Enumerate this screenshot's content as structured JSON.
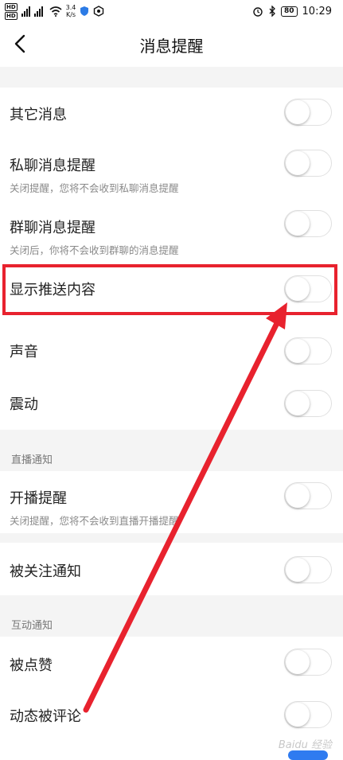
{
  "status_bar": {
    "hd1": "HD",
    "hd2": "HD",
    "net_speed_value": "3.4",
    "net_speed_unit": "K/s",
    "battery": "80",
    "time": "10:29"
  },
  "header": {
    "title": "消息提醒"
  },
  "settings": [
    {
      "label": "其它消息",
      "enabled": false
    },
    {
      "label": "私聊消息提醒",
      "sub": "关闭提醒，您将不会收到私聊消息提醒",
      "enabled": false
    },
    {
      "label": "群聊消息提醒",
      "sub": "关闭后，你将不会收到群聊的消息提醒",
      "enabled": false
    },
    {
      "label": "显示推送内容",
      "enabled": false
    },
    {
      "label": "声音",
      "enabled": false
    },
    {
      "label": "震动",
      "enabled": false
    }
  ],
  "live_section": {
    "title": "直播通知",
    "items": [
      {
        "label": "开播提醒",
        "sub": "关闭提醒，您将不会收到直播开播提醒",
        "enabled": false
      },
      {
        "label": "被关注通知",
        "enabled": false
      }
    ]
  },
  "interaction_section": {
    "title": "互动通知",
    "items": [
      {
        "label": "被点赞",
        "enabled": false
      },
      {
        "label": "动态被评论",
        "enabled": false
      }
    ]
  },
  "annotation": {
    "color": "#e8222e"
  },
  "watermark": "Baidu 经验"
}
